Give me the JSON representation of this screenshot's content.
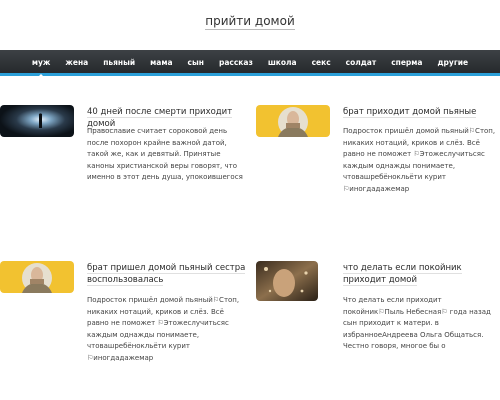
{
  "site": {
    "title": "прийти домой"
  },
  "nav": {
    "items": [
      "муж",
      "жена",
      "пьяный",
      "мама",
      "сын",
      "рассказ",
      "школа",
      "секс",
      "солдат",
      "сперма",
      "другие"
    ]
  },
  "articles": [
    {
      "title": "40 дней после смерти приходит домой",
      "excerpt": "Православие считает сороковой день после похорон крайне важной датой, такой же, как и девятый. Принятые каноны христианской веры говорят, что именно в этот день душа, упокоившегося"
    },
    {
      "title": "брат приходит домой пьяные",
      "excerpt": "Подросток пришёл домой пьяный⚐Стоп, никаких нотаций, криков и слёз. Всё равно не поможет ⚐Этожеслучитьсяс каждым однажды понимаете, чтовашребёнокльёти курит ⚐иногдадажемар"
    },
    {
      "title": "брат пришел домой пьяный сестра воспользовалась",
      "excerpt": "Подросток пришёл домой пьяный⚐Стоп, никаких нотаций, криков и слёз. Всё равно не поможет ⚐Этожеслучитьсяс каждым однажды понимаете, чтовашребёнокльёти курит ⚐иногдадажемар"
    },
    {
      "title": "что делать если покойник приходит домой",
      "excerpt": "Что делать если приходит покойник⚐Пыль Небесная⚐ года назад сын приходит к матери. в избранноеАндреева Ольга Общаться. Честно говоря, многое бы о"
    }
  ],
  "colors": {
    "nav_bg": "#2f3236",
    "nav_accent": "#2b9fd8"
  }
}
